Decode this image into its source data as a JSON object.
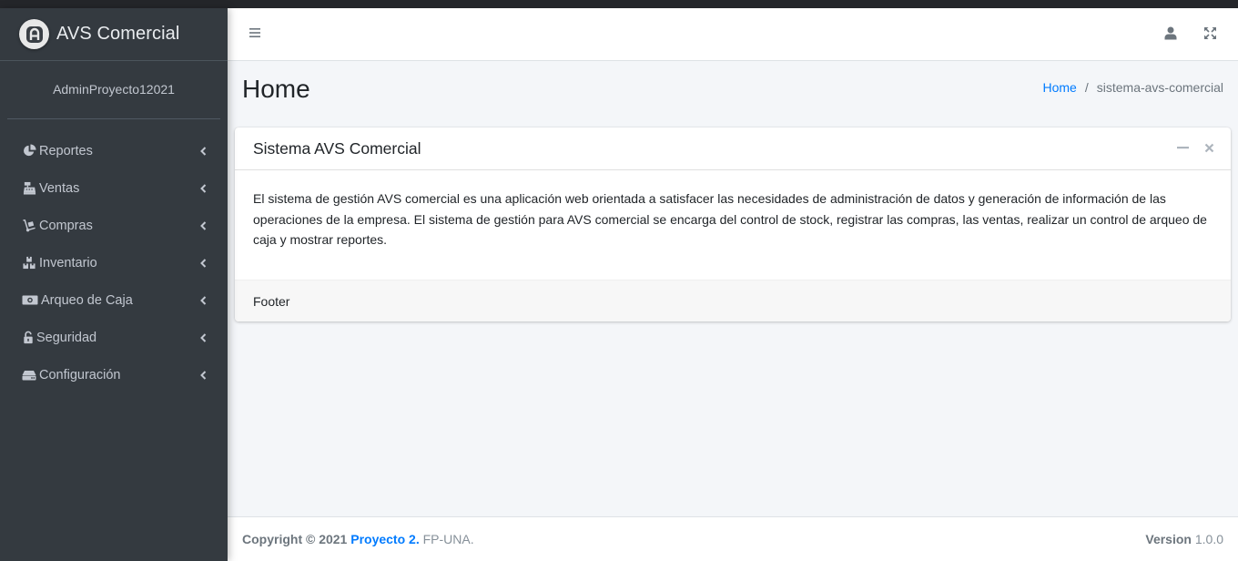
{
  "brand": {
    "title": "AVS Comercial"
  },
  "user": {
    "name": "AdminProyecto12021"
  },
  "sidebar": {
    "items": [
      {
        "label": "Reportes",
        "icon": "pie-chart-icon"
      },
      {
        "label": "Ventas",
        "icon": "cash-register-icon"
      },
      {
        "label": "Compras",
        "icon": "dolly-icon"
      },
      {
        "label": "Inventario",
        "icon": "boxes-icon"
      },
      {
        "label": "Arqueo de Caja",
        "icon": "money-bill-icon"
      },
      {
        "label": "Seguridad",
        "icon": "unlock-icon"
      },
      {
        "label": "Configuración",
        "icon": "hdd-icon"
      }
    ]
  },
  "content": {
    "title": "Home",
    "breadcrumb": {
      "home": "Home",
      "separator": "/",
      "current": "sistema-avs-comercial"
    }
  },
  "card": {
    "title": "Sistema AVS Comercial",
    "body": "El sistema de gestión AVS comercial es una aplicación web orientada a satisfacer las necesidades de administración de datos y generación de información de las operaciones de la empresa. El sistema de gestión para AVS comercial se encarga del control de stock, registrar las compras, las ventas, realizar un control de arqueo de caja y mostrar reportes.",
    "footer": "Footer"
  },
  "footer": {
    "copyright": "Copyright © 2021",
    "project": "Proyecto 2.",
    "org": "FP-UNA.",
    "version_label": "Version",
    "version": "1.0.0"
  },
  "colors": {
    "sidebar": "#343a40",
    "link": "#007bff",
    "background": "#f4f6f9"
  }
}
